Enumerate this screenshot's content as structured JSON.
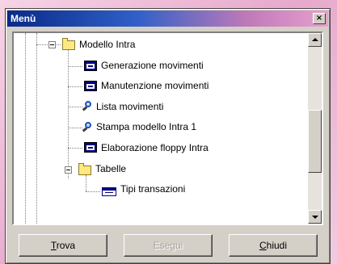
{
  "window": {
    "title": "Menù",
    "close_symbol": "×"
  },
  "tree": {
    "items": [
      {
        "label": "Modello Intra",
        "icon": "folder-icon"
      },
      {
        "label": "Generazione movimenti",
        "icon": "program-icon"
      },
      {
        "label": "Manutenzione movimenti",
        "icon": "program-icon"
      },
      {
        "label": "Lista movimenti",
        "icon": "search-icon"
      },
      {
        "label": "Stampa modello Intra 1",
        "icon": "search-icon"
      },
      {
        "label": "Elaborazione floppy Intra",
        "icon": "program-icon"
      },
      {
        "label": "Tabelle",
        "icon": "folder-icon"
      },
      {
        "label": "Tipi transazioni",
        "icon": "table-icon"
      }
    ]
  },
  "buttons": {
    "trova": {
      "accel": "T",
      "rest": "rova"
    },
    "esegui": {
      "label": "Esegui"
    },
    "chiudi": {
      "accel": "C",
      "rest": "hiudi"
    }
  }
}
